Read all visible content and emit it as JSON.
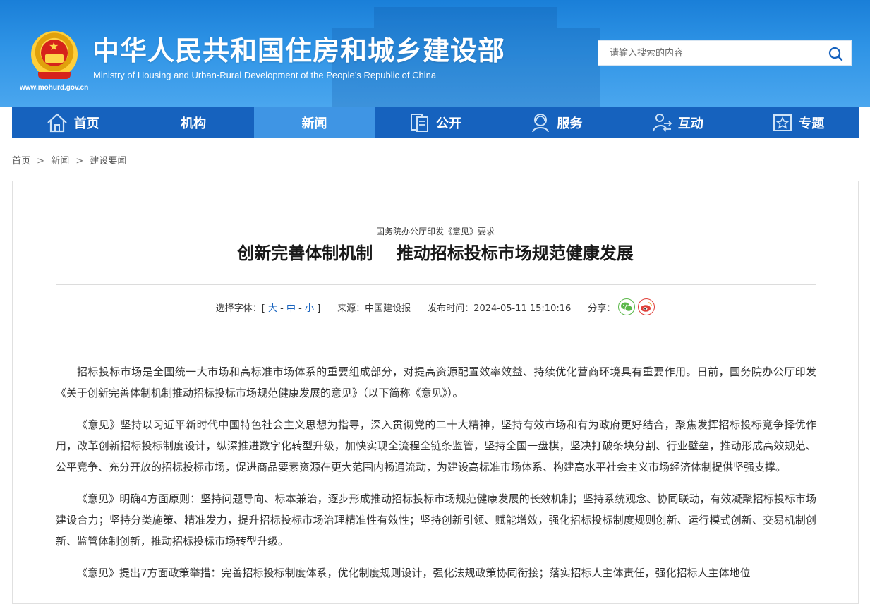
{
  "header": {
    "title_cn": "中华人民共和国住房和城乡建设部",
    "title_en": "Ministry of Housing and Urban-Rural Development of the People’s Republic of China",
    "site_url": "www.mohurd.gov.cn"
  },
  "search": {
    "placeholder": "请输入搜索的内容",
    "icon": "search-icon"
  },
  "nav": {
    "items": [
      {
        "label": "首页",
        "icon": "home-icon"
      },
      {
        "label": "机构",
        "icon": ""
      },
      {
        "label": "新闻",
        "icon": "",
        "active": true
      },
      {
        "label": "公开",
        "icon": "document-icon"
      },
      {
        "label": "服务",
        "icon": "service-icon"
      },
      {
        "label": "互动",
        "icon": "interaction-icon"
      },
      {
        "label": "专题",
        "icon": "star-box-icon"
      }
    ]
  },
  "breadcrumb": {
    "items": [
      "首页",
      "新闻",
      "建设要闻"
    ],
    "separator": ">"
  },
  "article": {
    "subtitle": "国务院办公厅印发《意见》要求",
    "title": "创新完善体制机制    推动招标投标市场规范健康发展",
    "font_select_label": "选择字体：[",
    "font_large": "大",
    "font_medium": "中",
    "font_small": "小",
    "font_close": "]",
    "font_dash": "-",
    "source": "来源：中国建设报",
    "publish_time": "发布时间：2024-05-11 15:10:16",
    "share_label": "分享：",
    "paragraphs": [
      "招标投标市场是全国统一大市场和高标准市场体系的重要组成部分，对提高资源配置效率效益、持续优化营商环境具有重要作用。日前，国务院办公厅印发《关于创新完善体制机制推动招标投标市场规范健康发展的意见》（以下简称《意见》）。",
      "《意见》坚持以习近平新时代中国特色社会主义思想为指导，深入贯彻党的二十大精神，坚持有效市场和有为政府更好结合，聚焦发挥招标投标竞争择优作用，改革创新招标投标制度设计，纵深推进数字化转型升级，加快实现全流程全链条监管，坚持全国一盘棋，坚决打破条块分割、行业壁垒，推动形成高效规范、公平竞争、充分开放的招标投标市场，促进商品要素资源在更大范围内畅通流动，为建设高标准市场体系、构建高水平社会主义市场经济体制提供坚强支撑。",
      "《意见》明确4方面原则：坚持问题导向、标本兼治，逐步形成推动招标投标市场规范健康发展的长效机制；坚持系统观念、协同联动，有效凝聚招标投标市场建设合力；坚持分类施策、精准发力，提升招标投标市场治理精准性有效性；坚持创新引领、赋能增效，强化招标投标制度规则创新、运行模式创新、交易机制创新、监管体制创新，推动招标投标市场转型升级。",
      "《意见》提出7方面政策举措：完善招标投标制度体系，优化制度规则设计，强化法规政策协同衔接；落实招标人主体责任，强化招标人主体地位"
    ]
  },
  "colors": {
    "nav_bg": "#1662be",
    "nav_active": "#3f95e4",
    "header_top": "#1a7fd8",
    "link": "#1662be"
  }
}
